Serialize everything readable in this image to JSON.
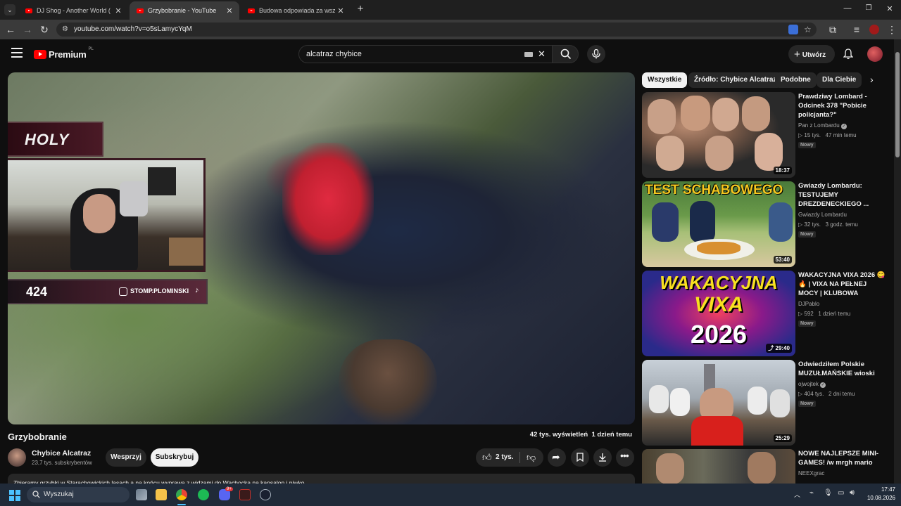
{
  "browser": {
    "tabs": [
      {
        "title": "DJ Shog - Another World ( Pol"
      },
      {
        "title": "Grzybobranie - YouTube"
      },
      {
        "title": "Budowa odpowiada za wszystk"
      }
    ],
    "url": "youtube.com/watch?v=o5sLamycYqM"
  },
  "youtube": {
    "logo_text": "Premium",
    "logo_sup": "PL",
    "search_value": "alcatraz chybice",
    "create_label": "Utwórz",
    "chips": [
      "Wszystkie",
      "Źródło: Chybice Alcatraz",
      "Podobne",
      "Dla Ciebie"
    ],
    "overlay": {
      "brand": "HOLY",
      "viewers": "424",
      "social": "STOMP.PLOMINSKI"
    },
    "video": {
      "title": "Grzybobranie",
      "stats": "42 tys. wyświetleń  1 dzień temu",
      "channel": "Chybice Alcatraz",
      "subscribers": "23,7 tys. subskrybentów",
      "support_label": "Wesprzyj",
      "subscribe_label": "Subskrybuj",
      "likes": "2 tys.",
      "description": "Zbieramy grzybki w Starachowickich lasach a na końcu wyprawa z widzami do Wachocka na kapsalon i piwko"
    },
    "recommendations": [
      {
        "title": "Prawdziwy Lombard - Odcinek 378 \"Pobicie policjanta?\"",
        "channel": "Pan z Lombardu",
        "verified": true,
        "meta": "▷ 15 tys.   47 min temu",
        "badge": "Nowy",
        "duration": "18:37"
      },
      {
        "title": "Gwiazdy Lombardu: TESTUJEMY DREZDENECKIEGO ...",
        "channel": "Gwiazdy Lombardu",
        "verified": false,
        "meta": "▷ 32 tys.   3 godz. temu",
        "badge": "Nowy",
        "duration": "53:40",
        "thumb_text": "TEST SCHABOWEGO"
      },
      {
        "title": "WAKACYJNA VIXA 2026 😋🔥 | VIXA NA PEŁNEJ MOCY | KLUBOWA PETARDA",
        "channel": "DJPablo",
        "verified": false,
        "meta": "▷ 592   1 dzień temu",
        "badge": "Nowy",
        "duration": "29:40",
        "thumb_text1": "WAKACYJNA",
        "thumb_text2": "VIXA",
        "thumb_text3": "2026"
      },
      {
        "title": "Odwiedziłem Polskie MUZUŁMAŃSKIE wioski",
        "channel": "ojwojtek",
        "verified": true,
        "meta": "▷ 404 tys.   2 dni temu",
        "badge": "Nowy",
        "duration": "25:29"
      },
      {
        "title": "NOWE NAJLEPSZE MINI-GAMES! /w mrgh mario remsua",
        "channel": "NEEXgrac",
        "verified": false,
        "meta": "",
        "badge": "",
        "duration": ""
      }
    ]
  },
  "taskbar": {
    "search_placeholder": "Wyszukaj",
    "time": "17:47",
    "date": "10.08.2026",
    "discord_badge": "9+"
  },
  "colors": {
    "yt_red": "#ff0000",
    "bg": "#0f0f0f",
    "chip_bg": "#272727"
  }
}
